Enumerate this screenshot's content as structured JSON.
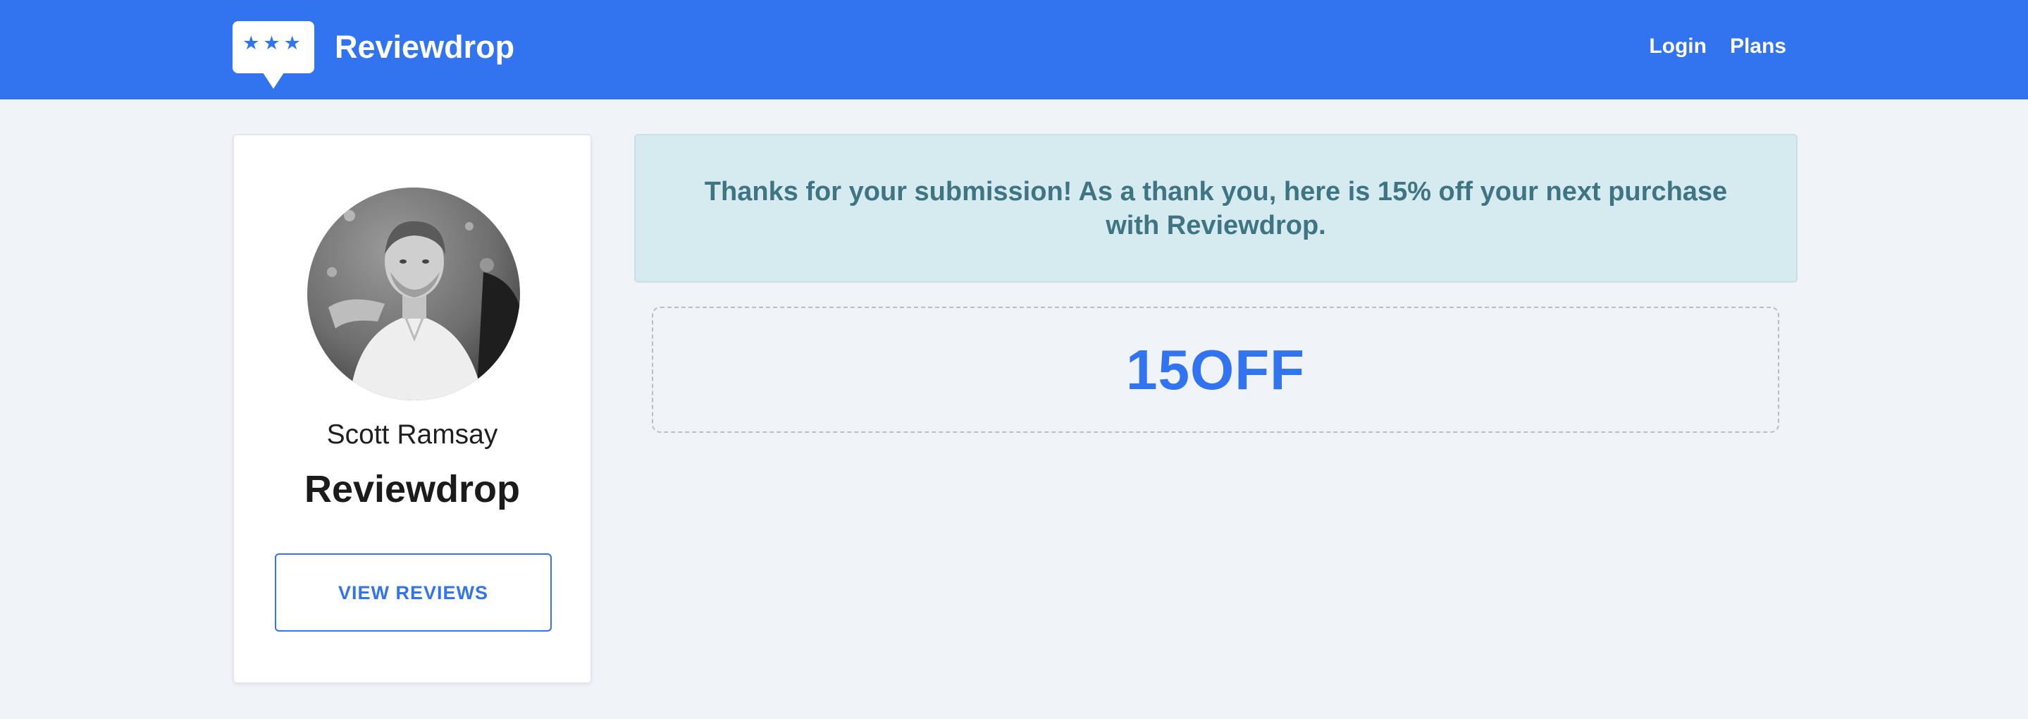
{
  "header": {
    "brand_name": "Reviewdrop",
    "logo_icon": "speech-bubble-three-stars-icon",
    "logo_stars": "★★★",
    "nav_links": [
      "Login",
      "Plans"
    ]
  },
  "profile": {
    "avatar": "profile-photo",
    "name": "Scott Ramsay",
    "company": "Reviewdrop",
    "button_label": "VIEW REVIEWS"
  },
  "alert": {
    "message": "Thanks for your submission! As a thank you, here is 15% off your next purchase with Reviewdrop."
  },
  "coupon": {
    "code": "15OFF"
  },
  "colors": {
    "primary": "#3273ef",
    "page_background": "#f0f4f9",
    "alert_background": "#d6ebef",
    "alert_text": "#3f7583"
  }
}
